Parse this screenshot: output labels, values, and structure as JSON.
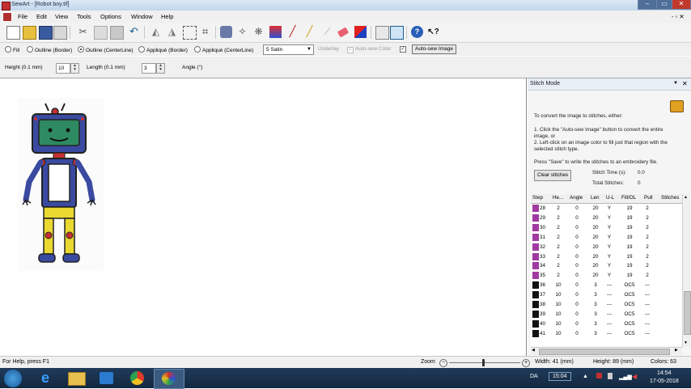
{
  "window": {
    "title": "SewArt - [Robot boy.tif]",
    "min": "–",
    "max": "▭",
    "close": "✕"
  },
  "menu": [
    "File",
    "Edit",
    "View",
    "Tools",
    "Options",
    "Window",
    "Help"
  ],
  "menu_right": "- ▫ ✕",
  "options": {
    "fill": "Fill",
    "outline_border": "Outline (Border)",
    "outline_centerline": "Outline (CenterLine)",
    "applique_border": "Appliqué (Border)",
    "applique_centerline": "Appliqué (CenterLine)",
    "satin_select": "5 Satin",
    "underlay": "Underlay",
    "auto_sew_color": "Auto-sew Color",
    "auto_sew_image_button": "Auto-sew Image"
  },
  "params": {
    "height_label": "Height (0.1 mm)",
    "height_value": "10",
    "length_label": "Length (0.1 mm)",
    "length_value": "3",
    "angle_label": "Angle (°)"
  },
  "panel": {
    "title": "Stitch Mode",
    "intro": "To convert the image to stitches, either:",
    "step1a": "1. Click the \"Auto-sew Image\" button to convert the entire",
    "step1b": "image, or",
    "step2a": "2. Left-click on an image color to fill just that region with the",
    "step2b": "selected stitch type.",
    "save_note": "Press \"Save\" to write the stitches to an embroidery file.",
    "clear_button": "Clear stitches",
    "stitch_time_label": "Stitch Time (s):",
    "stitch_time_value": "0.0",
    "total_label": "Total Stitches:",
    "total_value": "0"
  },
  "grid": {
    "headers": [
      "Step",
      "He...",
      "Angle",
      "Len",
      "U-L",
      "Fill/OL",
      "Pull",
      "Stitches"
    ],
    "rows": [
      {
        "swatch": "#a03aa0",
        "step": "28",
        "h": "2",
        "angle": "0",
        "len": "20",
        "ul": "Y",
        "fill": "19",
        "pull": "2",
        "st": ""
      },
      {
        "swatch": "#a03aa0",
        "step": "29",
        "h": "2",
        "angle": "0",
        "len": "20",
        "ul": "Y",
        "fill": "19",
        "pull": "2",
        "st": ""
      },
      {
        "swatch": "#a03aa0",
        "step": "30",
        "h": "2",
        "angle": "0",
        "len": "20",
        "ul": "Y",
        "fill": "19",
        "pull": "2",
        "st": ""
      },
      {
        "swatch": "#a03aa0",
        "step": "31",
        "h": "2",
        "angle": "0",
        "len": "20",
        "ul": "Y",
        "fill": "19",
        "pull": "2",
        "st": ""
      },
      {
        "swatch": "#a03aa0",
        "step": "32",
        "h": "2",
        "angle": "0",
        "len": "20",
        "ul": "Y",
        "fill": "19",
        "pull": "2",
        "st": ""
      },
      {
        "swatch": "#a03aa0",
        "step": "33",
        "h": "2",
        "angle": "0",
        "len": "20",
        "ul": "Y",
        "fill": "19",
        "pull": "2",
        "st": ""
      },
      {
        "swatch": "#a03aa0",
        "step": "34",
        "h": "2",
        "angle": "0",
        "len": "20",
        "ul": "Y",
        "fill": "19",
        "pull": "2",
        "st": ""
      },
      {
        "swatch": "#a03aa0",
        "step": "35",
        "h": "2",
        "angle": "0",
        "len": "20",
        "ul": "Y",
        "fill": "19",
        "pull": "2",
        "st": ""
      },
      {
        "swatch": "#111111",
        "step": "36",
        "h": "10",
        "angle": "0",
        "len": "3",
        "ul": "---",
        "fill": "OC5",
        "pull": "---",
        "st": ""
      },
      {
        "swatch": "#111111",
        "step": "37",
        "h": "10",
        "angle": "0",
        "len": "3",
        "ul": "---",
        "fill": "OC5",
        "pull": "---",
        "st": ""
      },
      {
        "swatch": "#111111",
        "step": "38",
        "h": "10",
        "angle": "0",
        "len": "3",
        "ul": "---",
        "fill": "OC5",
        "pull": "---",
        "st": ""
      },
      {
        "swatch": "#111111",
        "step": "39",
        "h": "10",
        "angle": "0",
        "len": "3",
        "ul": "---",
        "fill": "OC5",
        "pull": "---",
        "st": ""
      },
      {
        "swatch": "#111111",
        "step": "40",
        "h": "10",
        "angle": "0",
        "len": "3",
        "ul": "---",
        "fill": "OC5",
        "pull": "---",
        "st": ""
      },
      {
        "swatch": "#111111",
        "step": "41",
        "h": "10",
        "angle": "0",
        "len": "3",
        "ul": "---",
        "fill": "OC5",
        "pull": "---",
        "st": ""
      }
    ]
  },
  "status": {
    "help": "For Help, press F1",
    "zoom": "Zoom",
    "width": "Width: 41 (mm)",
    "height": "Height: 89 (mm)",
    "colors": "Colors: 63"
  },
  "taskbar": {
    "lang": "DA",
    "clock_box": "15:04",
    "time": "14:54",
    "date": "17-05-2018"
  },
  "colors": {
    "accent": "#1e5f8e",
    "robot_blue": "#3a4aa0",
    "robot_yellow": "#e8d830",
    "robot_green": "#2e8a60"
  }
}
